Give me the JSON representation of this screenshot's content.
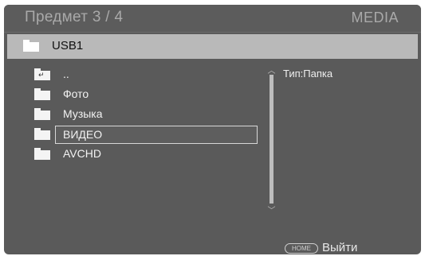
{
  "header": {
    "title": "Предмет 3 / 4",
    "mode": "MEDIA"
  },
  "path": {
    "label": "USB1",
    "icon": "folder-icon"
  },
  "files": [
    {
      "label": "..",
      "icon": "folder-up-icon"
    },
    {
      "label": "Фото",
      "icon": "folder-icon"
    },
    {
      "label": "Музыка",
      "icon": "folder-icon"
    },
    {
      "label": "ВИДЕО",
      "icon": "folder-icon",
      "selected": true
    },
    {
      "label": "AVCHD",
      "icon": "folder-icon"
    }
  ],
  "info": {
    "type_text": "Тип:Папка"
  },
  "footer": {
    "home_button": "HOME",
    "exit_label": "Выйти"
  },
  "colors": {
    "background": "#5a5a5a",
    "pathbar": "#b9b9b9",
    "selection_border": "#d8d8d8",
    "text": "#f2f2f2"
  }
}
